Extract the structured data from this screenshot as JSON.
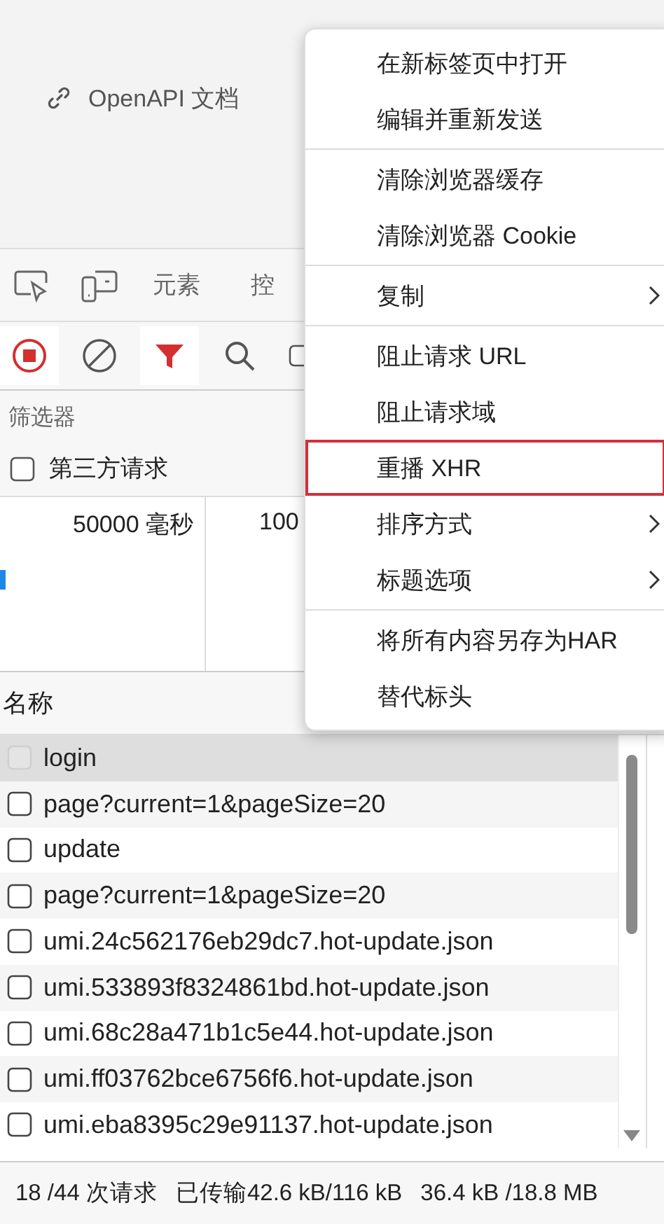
{
  "page": {
    "link": "OpenAPI 文档"
  },
  "devtools_tabs": [
    "元素",
    "控"
  ],
  "toolbar": {
    "recording": true,
    "filter_on": true
  },
  "filter": {
    "placeholder": "筛选器"
  },
  "third_party": {
    "label": "第三方请求",
    "checked": false
  },
  "overview": {
    "ticks": [
      "50000 毫秒",
      "100"
    ]
  },
  "table": {
    "column": "名称",
    "rows": [
      {
        "name": "login",
        "selected": true,
        "checked": false
      },
      {
        "name": "page?current=1&pageSize=20",
        "selected": false,
        "checked": false
      },
      {
        "name": "update",
        "selected": false,
        "checked": false
      },
      {
        "name": "page?current=1&pageSize=20",
        "selected": false,
        "checked": false
      },
      {
        "name": "umi.24c562176eb29dc7.hot-update.json",
        "selected": false,
        "checked": false
      },
      {
        "name": "umi.533893f8324861bd.hot-update.json",
        "selected": false,
        "checked": false
      },
      {
        "name": "umi.68c28a471b1c5e44.hot-update.json",
        "selected": false,
        "checked": false
      },
      {
        "name": "umi.ff03762bce6756f6.hot-update.json",
        "selected": false,
        "checked": false
      },
      {
        "name": "umi.eba8395c29e91137.hot-update.json",
        "selected": false,
        "checked": false
      }
    ]
  },
  "status_bar": {
    "requests": "18 /44 次请求",
    "transferred": "已传输42.6 kB/116 kB",
    "resources": "36.4 kB /18.8 MB"
  },
  "context_menu": {
    "groups": [
      [
        {
          "label": "在新标签页中打开",
          "submenu": false,
          "focused": false
        },
        {
          "label": "编辑并重新发送",
          "submenu": false,
          "focused": false
        }
      ],
      [
        {
          "label": "清除浏览器缓存",
          "submenu": false,
          "focused": false
        },
        {
          "label": "清除浏览器 Cookie",
          "submenu": false,
          "focused": false
        }
      ],
      [
        {
          "label": "复制",
          "submenu": true,
          "focused": false
        }
      ],
      [
        {
          "label": "阻止请求 URL",
          "submenu": false,
          "focused": false
        },
        {
          "label": "阻止请求域",
          "submenu": false,
          "focused": false
        },
        {
          "label": "重播 XHR",
          "submenu": false,
          "focused": true
        },
        {
          "label": "排序方式",
          "submenu": true,
          "focused": false
        },
        {
          "label": "标题选项",
          "submenu": true,
          "focused": false
        }
      ],
      [
        {
          "label": "将所有内容另存为HAR",
          "submenu": false,
          "focused": false
        },
        {
          "label": "替代标头",
          "submenu": false,
          "focused": false
        }
      ]
    ]
  }
}
